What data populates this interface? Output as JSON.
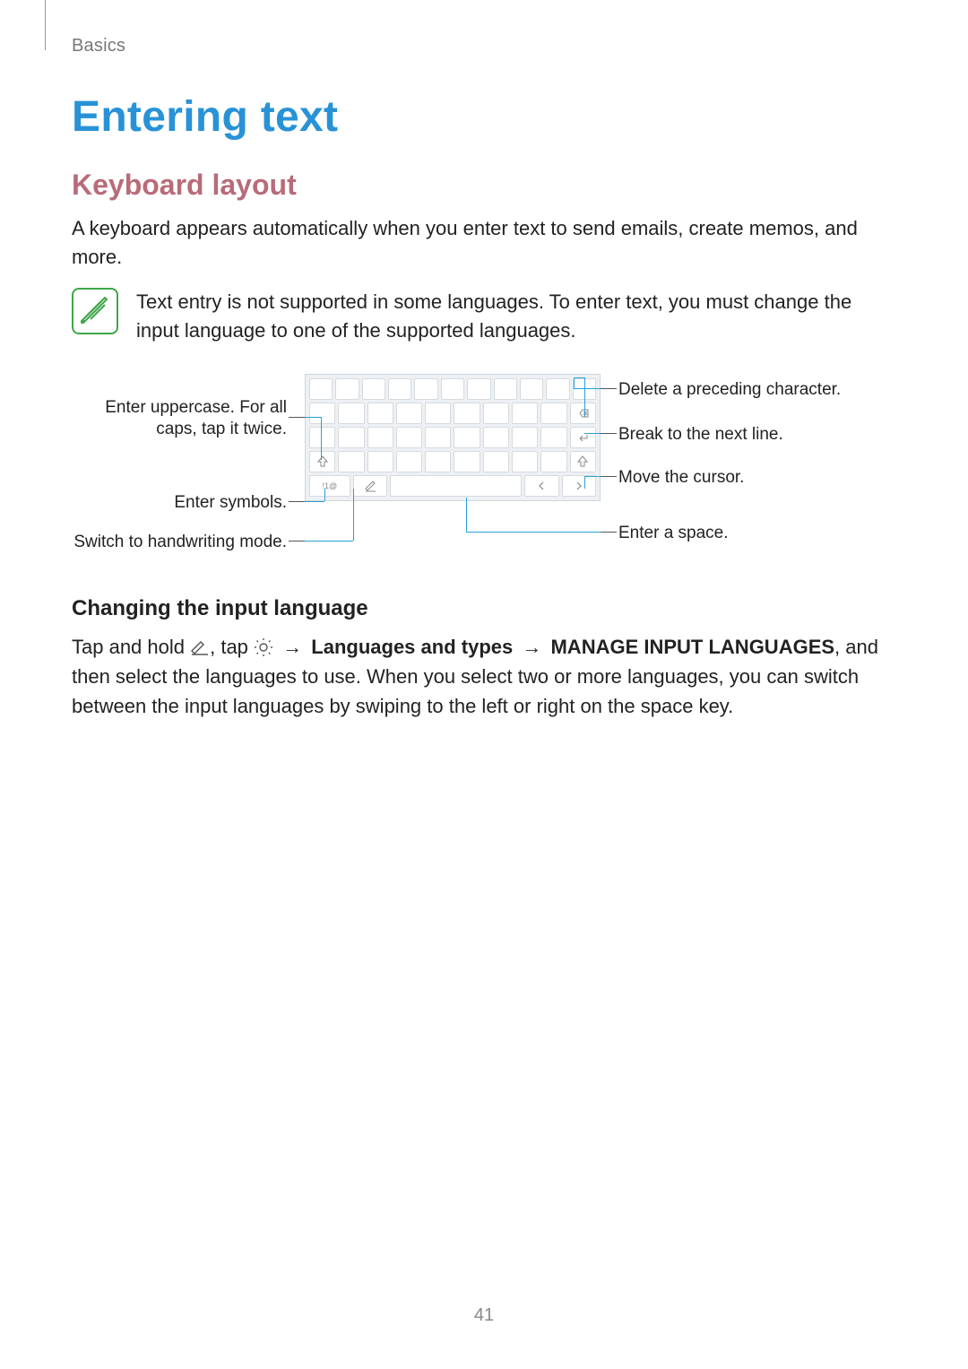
{
  "header": {
    "breadcrumb": "Basics"
  },
  "title": "Entering text",
  "section1": {
    "heading": "Keyboard layout",
    "intro": "A keyboard appears automatically when you enter text to send emails, create memos, and more.",
    "note": "Text entry is not supported in some languages. To enter text, you must change the input language to one of the supported languages."
  },
  "callouts": {
    "left": {
      "uppercase": "Enter uppercase. For all caps, tap it twice.",
      "symbols": "Enter symbols.",
      "handwriting": "Switch to handwriting mode."
    },
    "right": {
      "delete": "Delete a preceding character.",
      "break": "Break to the next line.",
      "cursor": "Move the cursor.",
      "space": "Enter a space."
    }
  },
  "section2": {
    "heading": "Changing the input language",
    "prefix": "Tap and hold ",
    "tap": ", tap ",
    "arrow": "→",
    "bold1": "Languages and types",
    "bold2": "MANAGE INPUT LANGUAGES",
    "tail": ", and then select the languages to use. When you select two or more languages, you can switch between the input languages by swiping to the left or right on the space key."
  },
  "page_number": "41",
  "icons": {
    "note": "note-pencil-icon",
    "handwriting": "handwriting-mode-icon",
    "settings": "settings-gear-icon"
  }
}
